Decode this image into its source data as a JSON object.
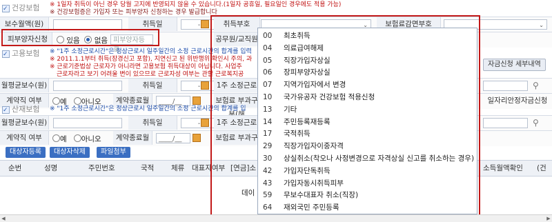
{
  "health": {
    "section_label": "건강보험",
    "notice1": "※ 1일자 취득이 아닌 경우 당월 고지에 반영되지 않을 수 있습니다.(1일자 공휴일, 필요일인 경우에도 적용 가능)",
    "notice2": "※ 건강보험증은 가입자 또는 피부양자 신청하는 경우 발급합니다",
    "wage_label": "보수월액(원)",
    "acq_date_label": "취득일",
    "acq_date_value": "- -",
    "acq_code_label": "취득부호",
    "reduction_label": "보험료감면부호",
    "dependent_label": "피부양자신청",
    "opt_yes": "있음",
    "opt_no": "없음",
    "dependent_placeholder": "피부양자등록",
    "official_label": "공무원/교직원"
  },
  "employment": {
    "section_label": "고용보험",
    "notice1": "※ \"1주 소정근로시간\"은 정상근로시 일주일간의 소정 근로시간의 합계를 입력",
    "notice2": "※ 2011.1.1부터 취득(장경신고 포함), 지연신고 된 위반행위 확인시 주의, 과",
    "notice3": "※ 근로기준법상 근로자가 아니라면 고용보험 취득대상이 아닙니다. 사업주",
    "notice4": "근로자라고 보기 어려울 변이 있으므로 근로자성 여부는 관할 근로복지공",
    "wage_label": "월평균보수(원)",
    "acq_date_label": "취득일",
    "acq_date_value": "- -",
    "hours_label": "1주 소정근로시",
    "contract_label": "계약직 여부",
    "opt_yes": "예",
    "opt_no": "아니오",
    "contract_end_label": "계약종료월",
    "contract_end_value": "____/__",
    "premium_label": "보험료 부과구분(해",
    "subsidy_detail_button": "자금신청 세부내역",
    "subsidy_label": "일자리안정자금신청"
  },
  "industrial": {
    "section_label": "산재보험",
    "notice1": "※ \"1주 소정근로시간\"은 정상근로시 일주일간의 소정 근로시간의 합계를 입",
    "wage_label": "월평균보수(원)",
    "acq_date_label": "취득일",
    "acq_date_value": "- -",
    "hours_label": "1주 소정근로시",
    "contract_label": "계약직 여부",
    "opt_yes": "예",
    "opt_no": "아니오",
    "contract_end_label": "계약종료월",
    "contract_end_value": "____/__",
    "premium_label": "보험료 부과구"
  },
  "toolbar": {
    "register_button": "대상자등록",
    "delete_button": "대상자삭제",
    "attach_button": "파일첨부"
  },
  "table": {
    "headers": [
      "순번",
      "성명",
      "주민번호",
      "국적",
      "체류",
      "대표자여부",
      "[연금]소",
      "소득월액확인",
      "(건"
    ],
    "empty_text": "데이"
  },
  "dropdown": {
    "current_value": "",
    "items": [
      {
        "code": "00",
        "name": "최초취득"
      },
      {
        "code": "04",
        "name": "의료급여해제"
      },
      {
        "code": "05",
        "name": "직장가입자상실"
      },
      {
        "code": "06",
        "name": "장피부양자상실"
      },
      {
        "code": "07",
        "name": "지역가입자에서 변경"
      },
      {
        "code": "10",
        "name": "국가유공자 건강보험 적용신청"
      },
      {
        "code": "13",
        "name": "기타"
      },
      {
        "code": "14",
        "name": "주민등록재등록"
      },
      {
        "code": "17",
        "name": "국적취득"
      },
      {
        "code": "29",
        "name": "직장가입자이중자격"
      },
      {
        "code": "30",
        "name": "상실취소(착오나 사정변경으로 자격상실 신고를 취소하는 경우)"
      },
      {
        "code": "42",
        "name": "가입자단독취득"
      },
      {
        "code": "43",
        "name": "가입자동시취득피부"
      },
      {
        "code": "59",
        "name": "무보수대표자 취소(직장)"
      },
      {
        "code": "64",
        "name": "재외국민 주민등록"
      }
    ]
  },
  "colors": {
    "highlight_border": "#c21818",
    "button_blue": "#3b6fc2",
    "notice_red": "#c01010"
  }
}
